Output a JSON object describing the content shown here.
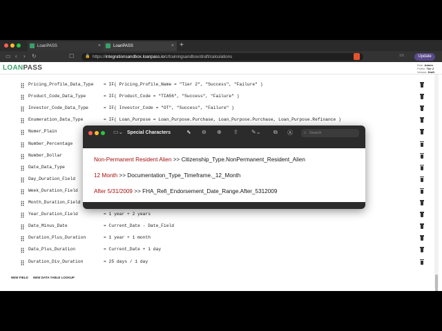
{
  "browser": {
    "tabs": [
      {
        "label": "LoanPASS"
      },
      {
        "label": "LoanPASS"
      }
    ],
    "url_scheme": "https://",
    "url_host": "integrationsandbox.loanpass.io",
    "url_path": "/c/trainingsandbox/draft/calculations",
    "update_label": "Update",
    "new_tab_symbol": "+"
  },
  "app": {
    "logo_loan": "LOAN",
    "logo_pass": "PASS",
    "user": {
      "role_label": "Role:",
      "role": "Admin",
      "profile_label": "Profile:",
      "profile": "Tier 2",
      "version_label": "Version:",
      "version": "Draft"
    }
  },
  "calculations": [
    {
      "name": "Pricing_Profile_Data_Type",
      "expr": "= IF( Pricing_Profile_Name = \"Tier 2\", \"Success\", \"Failure\" )"
    },
    {
      "name": "Product_Code_Data_Type",
      "expr": "= IF( Product_Code = \"TIA56\", \"Success\", \"Failure\" )"
    },
    {
      "name": "Investor_Code_Data_Type",
      "expr": "= IF( Investor_Code = \"OT\", \"Success\", \"Failure\" )"
    },
    {
      "name": "Enumeration_Data_Type",
      "expr": "= IF( Loan_Purpose = Loan_Purpose.Purchase, Loan_Purpose.Purchase, Loan_Purpose.Refinance )"
    },
    {
      "name": "Numer_Plain",
      "expr": ""
    },
    {
      "name": "Number_Percentage",
      "expr": ""
    },
    {
      "name": "Number_Dollar",
      "expr": ""
    },
    {
      "name": "Date_Data_Type",
      "expr": ""
    },
    {
      "name": "Day_Duration_Field",
      "expr": ""
    },
    {
      "name": "Week_Duration_Field",
      "expr": ""
    },
    {
      "name": "Month_Duration_Field",
      "expr": ""
    },
    {
      "name": "Year_Duration_Field",
      "expr": "= 1 year + 2 years"
    },
    {
      "name": "Date_Minus_Date",
      "expr": "= Current_Date - Date_Field"
    },
    {
      "name": "Duration_Plus_Duration",
      "expr": "= 1 year + 1 month"
    },
    {
      "name": "Date_Plus_Duration",
      "expr": "= Current_Date + 1 day"
    },
    {
      "name": "Duration_Div_Duration",
      "expr": "= 25 days / 1 day"
    }
  ],
  "footer_actions": {
    "new_field": "NEW FIELD",
    "new_lookup": "NEW DATA TABLE LOOKUP"
  },
  "popup": {
    "title": "Special Characters",
    "search_placeholder": "Search",
    "mappings": [
      {
        "source": "Non-Permanent Resident Alien",
        "arrow": ">>",
        "target": "Citizenship_Type.NonPermanent_Resident_Alien"
      },
      {
        "source": "12 Month",
        "arrow": ">>",
        "target": "Documentation_Type_Timeframe._12_Month"
      },
      {
        "source": "After 5/31/2009",
        "arrow": ">>",
        "target": "FHA_Refi_Endorsement_Date_Range.After_5312009"
      }
    ]
  },
  "colors": {
    "accent_green": "#3ca26a",
    "source_red": "#a31010",
    "update_purple": "#5a4a8a"
  }
}
